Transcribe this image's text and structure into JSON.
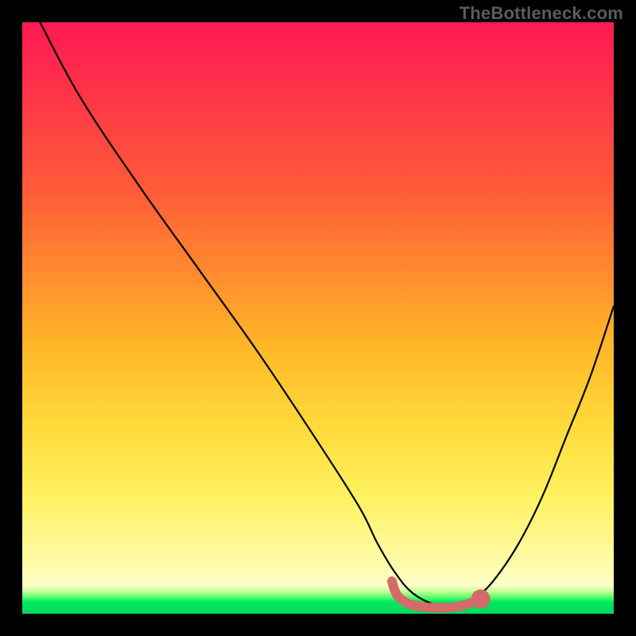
{
  "watermark": "TheBottleneck.com",
  "chart_data": {
    "type": "line",
    "title": "",
    "xlabel": "",
    "ylabel": "",
    "xlim": [
      0,
      100
    ],
    "ylim": [
      0,
      100
    ],
    "grid": false,
    "legend": false,
    "series": [
      {
        "name": "bottleneck-curve",
        "stroke": "#000000",
        "x": [
          3,
          10,
          20,
          30,
          40,
          50,
          57,
          60,
          63,
          66,
          70,
          74,
          77,
          80,
          84,
          88,
          92,
          96,
          100
        ],
        "values": [
          100,
          87,
          72,
          58,
          44,
          29,
          18,
          12,
          7,
          3.5,
          1.5,
          1.5,
          3,
          6,
          12,
          20,
          30,
          40,
          52
        ]
      }
    ],
    "highlight_segment": {
      "name": "optimal-range",
      "stroke": "#d46a6a",
      "points": [
        {
          "x": 62.5,
          "y": 5.5
        },
        {
          "x": 63.5,
          "y": 3.0
        },
        {
          "x": 66.0,
          "y": 1.5
        },
        {
          "x": 70.0,
          "y": 1.0
        },
        {
          "x": 74.0,
          "y": 1.3
        },
        {
          "x": 77.5,
          "y": 2.5
        }
      ],
      "end_dot": {
        "x": 77.5,
        "y": 2.5,
        "r": 1.2
      }
    },
    "gradient_stops": [
      {
        "pos": 0.0,
        "color": "#ff1a53"
      },
      {
        "pos": 0.55,
        "color": "#ffd93a"
      },
      {
        "pos": 0.95,
        "color": "#fcffc8"
      },
      {
        "pos": 1.0,
        "color": "#00d85a"
      }
    ]
  }
}
